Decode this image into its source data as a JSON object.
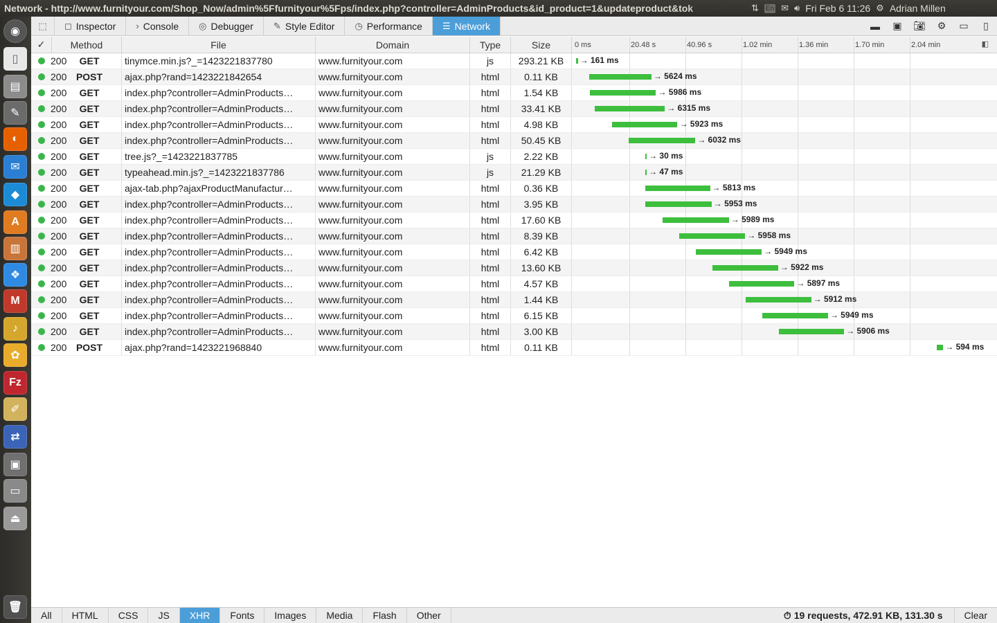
{
  "window": {
    "title": "Network - http://www.furnityour.com/Shop_Now/admin%5Ffurnityour%5Fps/index.php?controller=AdminProducts&id_product=1&updateproduct&tok",
    "lang": "En",
    "clock": "Fri Feb  6 11:26",
    "user": "Adrian Millen"
  },
  "toolbar": {
    "tabs": [
      {
        "label": "Inspector",
        "icon": "inspector-icon"
      },
      {
        "label": "Console",
        "icon": "console-icon"
      },
      {
        "label": "Debugger",
        "icon": "debugger-icon"
      },
      {
        "label": "Style Editor",
        "icon": "style-editor-icon"
      },
      {
        "label": "Performance",
        "icon": "performance-icon"
      },
      {
        "label": "Network",
        "icon": "network-icon",
        "active": true
      }
    ]
  },
  "table": {
    "headers": {
      "check": "✓",
      "method": "Method",
      "file": "File",
      "domain": "Domain",
      "type": "Type",
      "size": "Size"
    },
    "ticks": [
      "0 ms",
      "20.48 s",
      "40.96 s",
      "1.02 min",
      "1.36 min",
      "1.70 min",
      "2.04 min"
    ],
    "rows": [
      {
        "status": "200",
        "method": "GET",
        "file": "tinymce.min.js?_=1423221837780",
        "domain": "www.furnityour.com",
        "type": "js",
        "size": "293.21 KB",
        "start_s": 0.5,
        "duration_s": 0.161,
        "time_label": "→ 161 ms"
      },
      {
        "status": "200",
        "method": "POST",
        "file": "ajax.php?rand=1423221842654",
        "domain": "www.furnityour.com",
        "type": "html",
        "size": "0.11 KB",
        "start_s": 5.2,
        "duration_s": 5.624,
        "time_label": "→ 5624 ms"
      },
      {
        "status": "200",
        "method": "GET",
        "file": "index.php?controller=AdminProducts…",
        "domain": "www.furnityour.com",
        "type": "html",
        "size": "1.54 KB",
        "start_s": 5.4,
        "duration_s": 5.986,
        "time_label": "→ 5986 ms"
      },
      {
        "status": "200",
        "method": "GET",
        "file": "index.php?controller=AdminProducts…",
        "domain": "www.furnityour.com",
        "type": "html",
        "size": "33.41 KB",
        "start_s": 7.3,
        "duration_s": 6.315,
        "time_label": "→ 6315 ms"
      },
      {
        "status": "200",
        "method": "GET",
        "file": "index.php?controller=AdminProducts…",
        "domain": "www.furnityour.com",
        "type": "html",
        "size": "4.98 KB",
        "start_s": 13.4,
        "duration_s": 5.923,
        "time_label": "→ 5923 ms"
      },
      {
        "status": "200",
        "method": "GET",
        "file": "index.php?controller=AdminProducts…",
        "domain": "www.furnityour.com",
        "type": "html",
        "size": "50.45 KB",
        "start_s": 19.4,
        "duration_s": 6.032,
        "time_label": "→ 6032 ms"
      },
      {
        "status": "200",
        "method": "GET",
        "file": "tree.js?_=1423221837785",
        "domain": "www.furnityour.com",
        "type": "js",
        "size": "2.22 KB",
        "start_s": 25.5,
        "duration_s": 0.03,
        "time_label": "→ 30 ms"
      },
      {
        "status": "200",
        "method": "GET",
        "file": "typeahead.min.js?_=1423221837786",
        "domain": "www.furnityour.com",
        "type": "js",
        "size": "21.29 KB",
        "start_s": 25.5,
        "duration_s": 0.047,
        "time_label": "→ 47 ms"
      },
      {
        "status": "200",
        "method": "GET",
        "file": "ajax-tab.php?ajaxProductManufactur…",
        "domain": "www.furnityour.com",
        "type": "html",
        "size": "0.36 KB",
        "start_s": 25.6,
        "duration_s": 5.813,
        "time_label": "→ 5813 ms"
      },
      {
        "status": "200",
        "method": "GET",
        "file": "index.php?controller=AdminProducts…",
        "domain": "www.furnityour.com",
        "type": "html",
        "size": "3.95 KB",
        "start_s": 25.6,
        "duration_s": 5.953,
        "time_label": "→ 5953 ms"
      },
      {
        "status": "200",
        "method": "GET",
        "file": "index.php?controller=AdminProducts…",
        "domain": "www.furnityour.com",
        "type": "html",
        "size": "17.60 KB",
        "start_s": 31.7,
        "duration_s": 5.989,
        "time_label": "→ 5989 ms"
      },
      {
        "status": "200",
        "method": "GET",
        "file": "index.php?controller=AdminProducts…",
        "domain": "www.furnityour.com",
        "type": "html",
        "size": "8.39 KB",
        "start_s": 37.7,
        "duration_s": 5.958,
        "time_label": "→ 5958 ms"
      },
      {
        "status": "200",
        "method": "GET",
        "file": "index.php?controller=AdminProducts…",
        "domain": "www.furnityour.com",
        "type": "html",
        "size": "6.42 KB",
        "start_s": 43.7,
        "duration_s": 5.949,
        "time_label": "→ 5949 ms"
      },
      {
        "status": "200",
        "method": "GET",
        "file": "index.php?controller=AdminProducts…",
        "domain": "www.furnityour.com",
        "type": "html",
        "size": "13.60 KB",
        "start_s": 49.7,
        "duration_s": 5.922,
        "time_label": "→ 5922 ms"
      },
      {
        "status": "200",
        "method": "GET",
        "file": "index.php?controller=AdminProducts…",
        "domain": "www.furnityour.com",
        "type": "html",
        "size": "4.57 KB",
        "start_s": 55.7,
        "duration_s": 5.897,
        "time_label": "→ 5897 ms"
      },
      {
        "status": "200",
        "method": "GET",
        "file": "index.php?controller=AdminProducts…",
        "domain": "www.furnityour.com",
        "type": "html",
        "size": "1.44 KB",
        "start_s": 61.7,
        "duration_s": 5.912,
        "time_label": "→ 5912 ms"
      },
      {
        "status": "200",
        "method": "GET",
        "file": "index.php?controller=AdminProducts…",
        "domain": "www.furnityour.com",
        "type": "html",
        "size": "6.15 KB",
        "start_s": 67.6,
        "duration_s": 5.949,
        "time_label": "→ 5949 ms"
      },
      {
        "status": "200",
        "method": "GET",
        "file": "index.php?controller=AdminProducts…",
        "domain": "www.furnityour.com",
        "type": "html",
        "size": "3.00 KB",
        "start_s": 73.6,
        "duration_s": 5.906,
        "time_label": "→ 5906 ms"
      },
      {
        "status": "200",
        "method": "POST",
        "file": "ajax.php?rand=1423221968840",
        "domain": "www.furnityour.com",
        "type": "html",
        "size": "0.11 KB",
        "start_s": 130.6,
        "duration_s": 0.594,
        "time_label": "→ 594 ms"
      }
    ]
  },
  "filters": [
    "All",
    "HTML",
    "CSS",
    "JS",
    "XHR",
    "Fonts",
    "Images",
    "Media",
    "Flash",
    "Other"
  ],
  "active_filter": "XHR",
  "summary": "19 requests, 472.91 KB, 131.30 s",
  "clear_label": "Clear",
  "colors": {
    "accent": "#4c9ed9",
    "status_ok": "#39b54a",
    "bar": "#3dbf3d"
  }
}
